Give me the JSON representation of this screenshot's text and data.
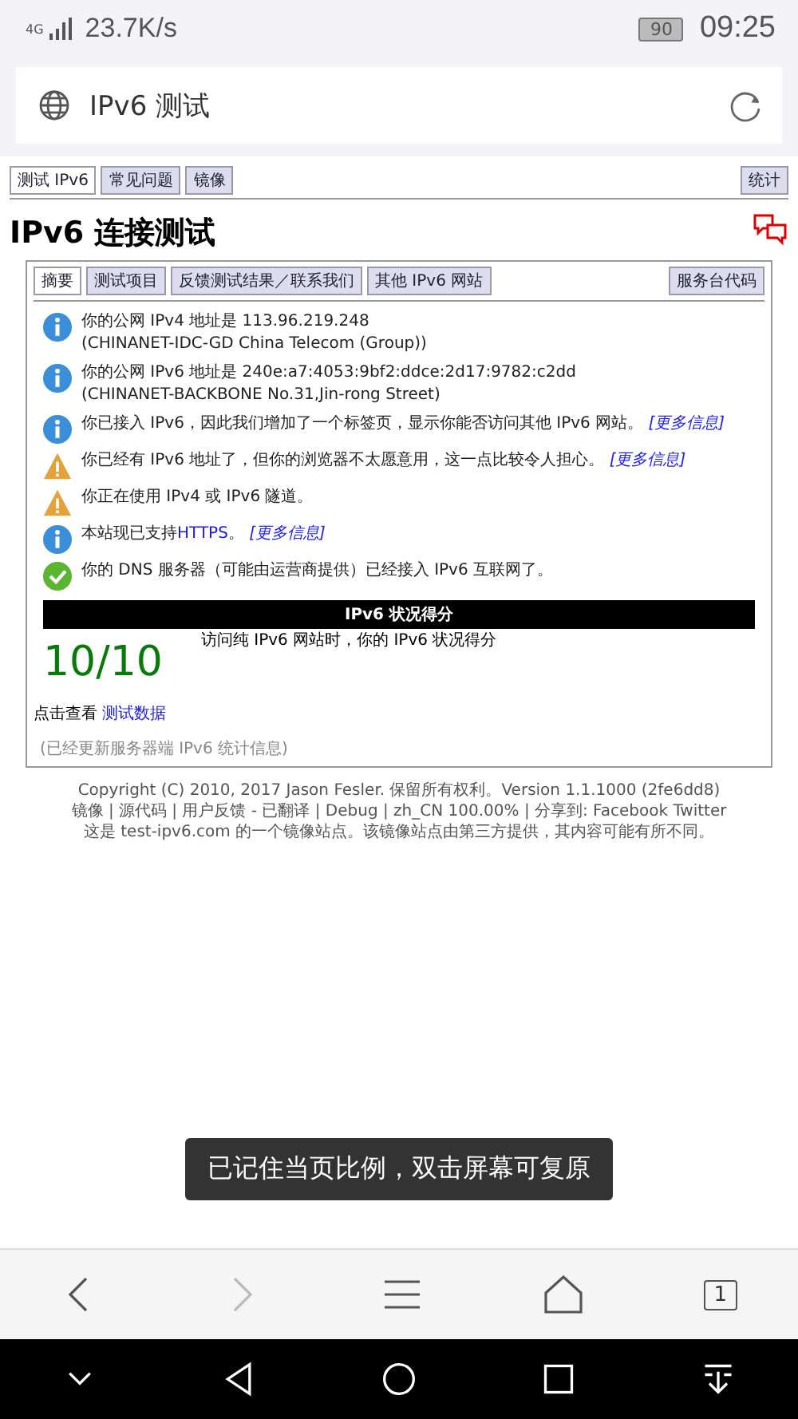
{
  "status_bar": {
    "network": "4G",
    "speed": "23.7K/s",
    "battery": "90",
    "time": "09:25"
  },
  "address_bar": {
    "title": "IPv6 测试"
  },
  "page": {
    "top_tabs": [
      {
        "label": "测试 IPv6",
        "selected": true
      },
      {
        "label": "常见问题",
        "selected": false
      },
      {
        "label": "镜像",
        "selected": false
      }
    ],
    "top_right_tab": "统计",
    "heading": "IPv6 连接测试",
    "inner_tabs": [
      {
        "label": "摘要",
        "selected": true
      },
      {
        "label": "测试项目",
        "selected": false
      },
      {
        "label": "反馈测试结果／联系我们",
        "selected": false
      },
      {
        "label": "其他 IPv6 网站",
        "selected": false
      }
    ],
    "inner_right_tab": "服务台代码",
    "results": [
      {
        "kind": "info",
        "text": "你的公网 IPv4 地址是 113.96.219.248",
        "subtext": "(CHINANET-IDC-GD China Telecom (Group))"
      },
      {
        "kind": "info",
        "text": "你的公网 IPv6 地址是 240e:a7:4053:9bf2:ddce:2d17:9782:c2dd",
        "subtext": "(CHINANET-BACKBONE No.31,Jin-rong Street)"
      },
      {
        "kind": "info",
        "text": "你已接入 IPv6，因此我们增加了一个标签页，显示你能否访问其他 IPv6 网站。",
        "more": "[更多信息]"
      },
      {
        "kind": "warning",
        "text": "你已经有 IPv6 地址了，但你的浏览器不太愿意用，这一点比较令人担心。",
        "more": "[更多信息]"
      },
      {
        "kind": "warning",
        "text": "你正在使用 IPv4 或 IPv6 隧道。"
      },
      {
        "kind": "info",
        "text": "本站现已支持",
        "link": "HTTPS",
        "text_after": "。",
        "more": "[更多信息]"
      },
      {
        "kind": "ok",
        "text": "你的 DNS 服务器（可能由运营商提供）已经接入 IPv6 互联网了。"
      }
    ],
    "score": {
      "header": "IPv6 状况得分",
      "caption": "访问纯 IPv6 网站时，你的 IPv6 状况得分",
      "value": "10/10"
    },
    "data_link": {
      "prefix": "点击查看",
      "link": "测试数据"
    },
    "note": "(已经更新服务器端 IPv6 统计信息)",
    "footer": [
      "Copyright (C) 2010, 2017 Jason Fesler. 保留所有权利。Version 1.1.1000 (2fe6dd8)",
      "镜像 | 源代码 | 用户反馈 - 已翻译 | Debug | zh_CN 100.00% | 分享到: Facebook Twitter",
      "这是 test-ipv6.com 的一个镜像站点。该镜像站点由第三方提供，其内容可能有所不同。"
    ]
  },
  "toast": "已记住当页比例，双击屏幕可复原",
  "toolbar": {
    "back_disabled": false,
    "forward_disabled": true,
    "tab_count": "1"
  }
}
